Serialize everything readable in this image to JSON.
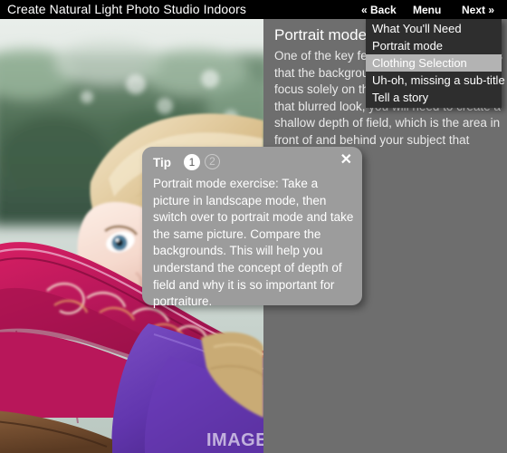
{
  "titlebar": {
    "title": "Create Natural Light Photo Studio Indoors",
    "nav": {
      "back": "« Back",
      "menu": "Menu",
      "next": "Next »"
    }
  },
  "menu": {
    "items": [
      {
        "label": "What You'll Need",
        "selected": false
      },
      {
        "label": "Portrait mode",
        "selected": false
      },
      {
        "label": "Clothing Selection",
        "selected": true
      },
      {
        "label": "Uh-oh, missing a sub-title",
        "selected": false
      },
      {
        "label": "Tell a story",
        "selected": false
      }
    ]
  },
  "content": {
    "heading": "Portrait mode",
    "body": "One of the key features of portrait mode is that the background is blurred, placing the focus solely on the subject. To accomplish that blurred look, you will need to create a shallow depth of field, which is the area in front of and behind your subject that appears to be in"
  },
  "tip": {
    "label": "Tip",
    "pages": [
      "1",
      "2"
    ],
    "close": "✕",
    "body": "Portrait mode exercise: Take a picture in landscape mode, then switch over to portrait mode and take the same picture. Compare the backgrounds. This will help you understand the concept of depth of field and why it is so important for portraiture."
  },
  "photo": {
    "watermark": "IMAGE BA",
    "alt": "Blonde girl in magenta puffer jacket lying on a wooden bench with blurred green foliage background"
  },
  "colors": {
    "titlebar_bg": "#000000",
    "panel_bg": "#6e6e6e",
    "menu_bg": "#2e2e2e",
    "menu_selected_bg": "#b3b3b3",
    "tip_bg": "#9c9c9c",
    "text_primary": "#ffffff"
  }
}
